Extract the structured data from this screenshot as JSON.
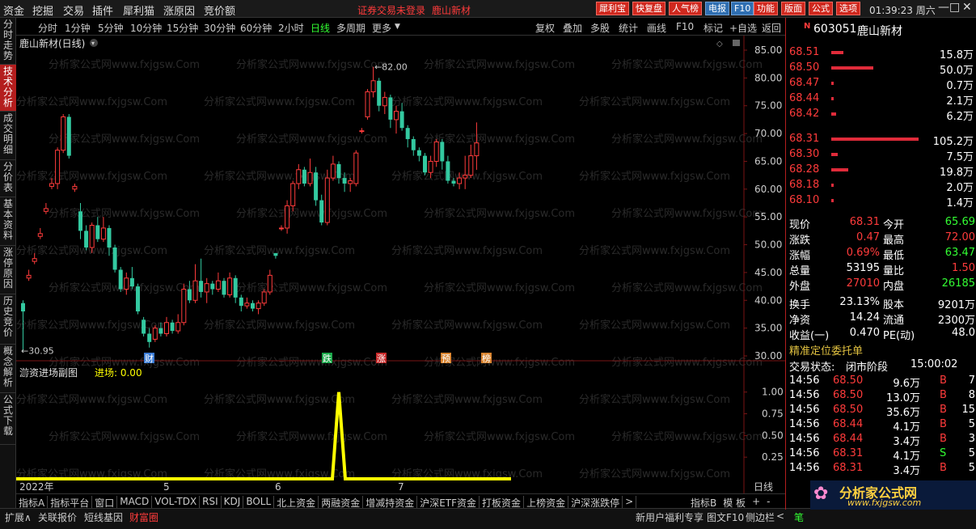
{
  "menubar": {
    "items": [
      "资金",
      "挖掘",
      "交易",
      "插件",
      "犀利猫",
      "涨原因",
      "竞价额"
    ],
    "status_text": "证券交易未登录",
    "stock_title": "鹿山新材",
    "tool_buttons": [
      "犀利宝",
      "快复盘",
      "人气榜",
      "电报",
      "F10",
      "功能",
      "版面",
      "公式",
      "选项"
    ],
    "clock": "01:39:23 周六",
    "window_controls": [
      "—",
      "□",
      "✕"
    ]
  },
  "sidebar": {
    "tabs": [
      "分时走势",
      "技术分析",
      "成交明细",
      "分价表",
      "基本资料",
      "涨停原因",
      "历史竞价",
      "概念解析",
      "公式下载"
    ],
    "active_index": 1
  },
  "periodbar": {
    "periods": [
      "分时",
      "1分钟",
      "5分钟",
      "10分钟",
      "15分钟",
      "30分钟",
      "60分钟",
      "2小时",
      "日线",
      "多周期",
      "更多"
    ],
    "active": "日线",
    "right_tools": [
      "复权",
      "叠加",
      "多股",
      "统计",
      "画线",
      "F10",
      "标记",
      "+自选",
      "返回"
    ]
  },
  "main_chart": {
    "title": "鹿山新材(日线)",
    "price_axis": [
      "85.00",
      "80.00",
      "75.00",
      "70.00",
      "65.00",
      "60.00",
      "55.00",
      "50.00",
      "45.00",
      "40.00",
      "35.00",
      "30.00"
    ],
    "high_label": "82.00",
    "low_label": "30.95",
    "watermark": "分析家公式网www.fxjgsw.Com",
    "event_markers": [
      {
        "text": "财",
        "color": "#3a7bd5"
      },
      {
        "text": "跌",
        "color": "#1aa84a"
      },
      {
        "text": "涨",
        "color": "#c62828"
      },
      {
        "text": "预",
        "color": "#d9822b"
      },
      {
        "text": "榜",
        "color": "#d9822b"
      }
    ]
  },
  "sub_chart": {
    "title": "游资进场副图",
    "value_label": "进场: 0.00",
    "axis": [
      "1.00",
      "0.75",
      "0.50",
      "0.25"
    ],
    "date_labels": [
      "2022年",
      "5",
      "6",
      "7"
    ],
    "period_label": "日线"
  },
  "indicator_tabs": [
    "指标A",
    "指标平台",
    "窗口",
    "MACD",
    "VOL-TDX",
    "RSI",
    "KDJ",
    "BOLL",
    "北上资金",
    "两融资金",
    "增减持资金",
    "沪深ETF资金",
    "打板资金",
    "上榜资金",
    "沪深涨跌停",
    ">"
  ],
  "indicator_right": [
    "指标B",
    "模 板",
    "+",
    "-"
  ],
  "statusbar": {
    "left": [
      "扩展∧",
      "关联报价",
      "短线基因",
      "财富圈"
    ],
    "right": [
      "新用户福利专享",
      "图文F10",
      "侧边栏",
      "<",
      "笔"
    ]
  },
  "quote_panel": {
    "code": "603051",
    "name": "鹿山新材",
    "asks": [
      {
        "price": "68.51",
        "vol": "15.8万",
        "bar": 0.14
      },
      {
        "price": "68.50",
        "vol": "50.0万",
        "bar": 0.48
      },
      {
        "price": "68.47",
        "vol": "0.7万",
        "bar": 0.02
      },
      {
        "price": "68.44",
        "vol": "2.1万",
        "bar": 0.03
      },
      {
        "price": "68.42",
        "vol": "6.2万",
        "bar": 0.06
      }
    ],
    "bids": [
      {
        "price": "68.31",
        "vol": "105.2万",
        "bar": 1.0
      },
      {
        "price": "68.30",
        "vol": "7.5万",
        "bar": 0.07
      },
      {
        "price": "68.28",
        "vol": "19.8万",
        "bar": 0.19
      },
      {
        "price": "68.18",
        "vol": "2.0万",
        "bar": 0.02
      },
      {
        "price": "68.10",
        "vol": "1.4万",
        "bar": 0.02
      }
    ],
    "stats": [
      {
        "k1": "现价",
        "v1": "68.31",
        "c1": "#ff3b3b",
        "k2": "今开",
        "v2": "65.69",
        "c2": "#33ff33"
      },
      {
        "k1": "涨跌",
        "v1": "0.47",
        "c1": "#ff3b3b",
        "k2": "最高",
        "v2": "72.00",
        "c2": "#ff3b3b"
      },
      {
        "k1": "涨幅",
        "v1": "0.69%",
        "c1": "#ff3b3b",
        "k2": "最低",
        "v2": "63.47",
        "c2": "#33ff33"
      },
      {
        "k1": "总量",
        "v1": "53195",
        "c1": "#ffffff",
        "k2": "量比",
        "v2": "1.50",
        "c2": "#ff3b3b"
      },
      {
        "k1": "外盘",
        "v1": "27010",
        "c1": "#ff3b3b",
        "k2": "内盘",
        "v2": "26185",
        "c2": "#33ff33"
      },
      {
        "k1": "换手",
        "v1": "23.13%",
        "c1": "#ffffff",
        "k2": "股本",
        "v2": "9201万",
        "c2": "#ffffff"
      },
      {
        "k1": "净资",
        "v1": "14.24",
        "c1": "#ffffff",
        "k2": "流通",
        "v2": "2300万",
        "c2": "#ffffff"
      },
      {
        "k1": "收益(一)",
        "v1": "0.470",
        "c1": "#ffffff",
        "k2": "PE(动)",
        "v2": "48.0",
        "c2": "#ffffff"
      }
    ],
    "order_title": "精准定位委托单",
    "trade_state_label": "交易状态:",
    "trade_state": "闭市阶段",
    "trade_time": "15:00:02",
    "trades": [
      {
        "t": "14:56",
        "p": "68.50",
        "v": "9.6万",
        "d": "B",
        "n": "7"
      },
      {
        "t": "14:56",
        "p": "68.50",
        "v": "13.0万",
        "d": "B",
        "n": "8"
      },
      {
        "t": "14:56",
        "p": "68.50",
        "v": "35.6万",
        "d": "B",
        "n": "15"
      },
      {
        "t": "14:56",
        "p": "68.44",
        "v": "4.1万",
        "d": "B",
        "n": "5"
      },
      {
        "t": "14:56",
        "p": "68.44",
        "v": "3.4万",
        "d": "B",
        "n": "3"
      },
      {
        "t": "14:56",
        "p": "68.31",
        "v": "4.1万",
        "d": "S",
        "n": "5"
      },
      {
        "t": "14:56",
        "p": "68.31",
        "v": "3.4万",
        "d": "B",
        "n": "5"
      }
    ],
    "logo_text": "分析家公式网",
    "logo_url": "www.fxjgsw.com"
  },
  "chart_data": {
    "type": "candlestick",
    "ylim": [
      30,
      85
    ],
    "candles": [
      [
        39.5,
        38.0,
        40.0,
        30.95
      ],
      [
        44.0,
        44.5,
        45.5,
        43.5
      ],
      [
        47.0,
        47.5,
        48.5,
        46.5
      ],
      [
        51.5,
        52.0,
        53.0,
        51.0
      ],
      [
        56.0,
        56.5,
        57.5,
        55.5
      ],
      [
        60.5,
        61.0,
        62.0,
        60.0
      ],
      [
        61.0,
        67.0,
        67.5,
        60.0
      ],
      [
        67.0,
        73.0,
        73.5,
        66.5
      ],
      [
        73.0,
        66.0,
        73.5,
        65.5
      ],
      [
        60.0,
        60.5,
        61.0,
        59.5
      ],
      [
        56.0,
        52.5,
        57.5,
        51.0
      ],
      [
        52.5,
        49.5,
        53.5,
        49.0
      ],
      [
        49.5,
        53.5,
        54.0,
        48.5
      ],
      [
        53.5,
        51.0,
        55.0,
        50.5
      ],
      [
        51.0,
        53.0,
        55.0,
        50.5
      ],
      [
        53.0,
        49.5,
        53.5,
        48.0
      ],
      [
        49.5,
        45.5,
        50.0,
        45.0
      ],
      [
        45.5,
        42.0,
        46.0,
        41.5
      ],
      [
        42.0,
        44.0,
        45.0,
        41.0
      ],
      [
        44.0,
        42.5,
        46.0,
        42.0
      ],
      [
        42.5,
        38.0,
        43.0,
        37.5
      ],
      [
        36.5,
        34.0,
        37.0,
        33.5
      ],
      [
        34.0,
        32.5,
        35.0,
        31.5
      ],
      [
        33.0,
        35.0,
        35.5,
        32.5
      ],
      [
        35.0,
        34.0,
        36.0,
        33.5
      ],
      [
        34.0,
        36.0,
        37.0,
        33.5
      ],
      [
        36.0,
        34.5,
        36.5,
        34.0
      ],
      [
        34.5,
        36.0,
        37.5,
        34.0
      ],
      [
        36.0,
        42.0,
        43.0,
        35.5
      ],
      [
        42.0,
        40.0,
        43.5,
        39.5
      ],
      [
        40.0,
        43.5,
        46.5,
        39.5
      ],
      [
        43.5,
        41.5,
        47.5,
        40.5
      ],
      [
        41.5,
        43.0,
        44.0,
        39.5
      ],
      [
        43.0,
        42.0,
        43.5,
        41.0
      ],
      [
        42.0,
        43.5,
        45.0,
        41.5
      ],
      [
        43.5,
        41.0,
        44.0,
        40.5
      ],
      [
        41.0,
        44.0,
        45.0,
        40.5
      ],
      [
        44.0,
        40.5,
        44.5,
        39.5
      ],
      [
        40.5,
        39.0,
        41.0,
        38.0
      ],
      [
        39.0,
        39.5,
        40.5,
        38.5
      ],
      [
        39.5,
        38.5,
        40.0,
        38.0
      ],
      [
        38.5,
        39.5,
        40.0,
        37.5
      ],
      [
        39.5,
        41.5,
        42.0,
        39.0
      ],
      [
        41.5,
        44.5,
        45.5,
        41.0
      ],
      [
        48.5,
        48.0,
        48.5,
        47.5
      ],
      [
        53.0,
        53.0,
        53.5,
        52.5
      ],
      [
        53.0,
        57.0,
        58.0,
        52.0
      ],
      [
        57.0,
        61.0,
        61.5,
        56.0
      ],
      [
        61.0,
        63.5,
        64.5,
        60.0
      ],
      [
        63.5,
        61.0,
        64.0,
        60.5
      ],
      [
        61.0,
        63.0,
        65.5,
        60.5
      ],
      [
        63.0,
        58.0,
        64.0,
        57.0
      ],
      [
        58.0,
        54.0,
        59.0,
        53.5
      ],
      [
        54.0,
        62.0,
        63.5,
        53.5
      ],
      [
        62.0,
        64.5,
        66.0,
        61.5
      ],
      [
        64.5,
        62.0,
        65.0,
        61.0
      ],
      [
        62.0,
        61.0,
        63.0,
        59.5
      ],
      [
        61.0,
        61.5,
        62.0,
        59.5
      ],
      [
        61.0,
        66.5,
        67.0,
        60.5
      ],
      [
        70.5,
        70.5,
        71.0,
        70.0
      ],
      [
        73.0,
        77.5,
        78.0,
        72.5
      ],
      [
        77.5,
        79.5,
        82.0,
        76.5
      ],
      [
        79.5,
        75.0,
        80.0,
        74.0
      ],
      [
        75.0,
        76.5,
        77.5,
        73.5
      ],
      [
        76.5,
        72.5,
        77.0,
        71.0
      ],
      [
        72.5,
        74.0,
        75.0,
        70.0
      ],
      [
        74.0,
        71.0,
        75.5,
        70.5
      ],
      [
        71.0,
        69.0,
        71.5,
        67.5
      ],
      [
        69.0,
        67.0,
        69.5,
        66.0
      ],
      [
        67.0,
        66.0,
        67.5,
        65.0
      ],
      [
        66.0,
        63.0,
        66.5,
        62.5
      ],
      [
        63.0,
        65.0,
        66.0,
        62.0
      ],
      [
        65.0,
        68.5,
        69.0,
        64.0
      ],
      [
        68.5,
        65.0,
        69.0,
        63.5
      ],
      [
        65.0,
        61.5,
        66.0,
        61.0
      ],
      [
        61.5,
        61.0,
        62.0,
        60.5
      ],
      [
        61.0,
        62.0,
        63.0,
        60.0
      ],
      [
        62.0,
        62.5,
        66.0,
        60.0
      ],
      [
        62.5,
        66.0,
        68.0,
        62.0
      ],
      [
        66.0,
        68.31,
        72.0,
        63.47
      ]
    ],
    "sub_series": {
      "name": "进场",
      "ylim": [
        0,
        1.1
      ],
      "values": [
        0,
        0,
        0,
        0,
        0,
        0,
        0,
        0,
        0,
        0,
        0,
        0,
        0,
        0,
        0,
        0,
        0,
        0,
        0,
        0,
        0,
        0,
        0,
        0,
        0,
        0,
        0,
        0,
        0,
        0,
        0,
        0,
        0,
        0,
        0,
        0,
        0,
        0,
        0,
        0,
        0,
        0,
        0,
        0,
        0,
        0,
        0,
        0,
        0,
        0,
        0,
        0,
        0,
        0,
        0,
        0,
        0,
        0,
        0,
        0,
        0,
        0,
        0,
        0,
        0,
        0,
        0,
        0,
        0,
        0,
        0,
        0,
        0,
        0,
        0,
        0,
        0,
        0,
        0,
        0
      ],
      "spike_index": 55,
      "spike_value": 1.0
    },
    "up_color": "#ff3b3b",
    "down_color": "#33c9a0",
    "sub_color": "#ffff00"
  }
}
